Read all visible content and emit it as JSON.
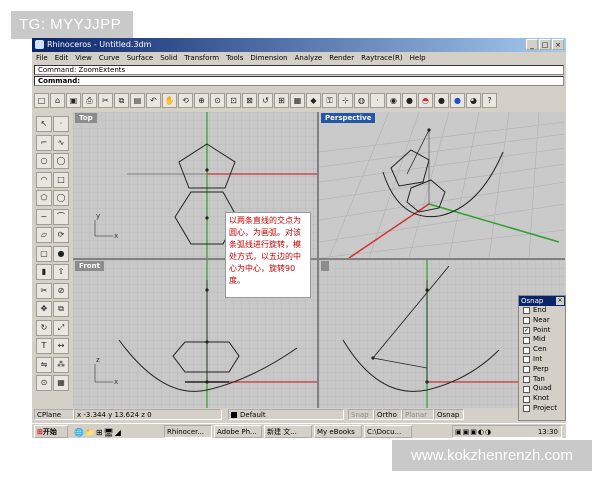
{
  "watermark_top": "TG: MYYJJPP",
  "watermark_bottom": "www.kokzhenrenzh.com",
  "window": {
    "title": "Rhinoceros - Untitled.3dm",
    "buttons": [
      "_",
      "□",
      "×"
    ]
  },
  "menu": [
    "File",
    "Edit",
    "View",
    "Curve",
    "Surface",
    "Solid",
    "Transform",
    "Tools",
    "Dimension",
    "Analyze",
    "Render",
    "Raytrace(R)",
    "Help"
  ],
  "command_history": "Command: ZoomExtents",
  "command_prompt": "Command:",
  "toolbar_icons": [
    "new-icon",
    "open-icon",
    "save-icon",
    "print-icon",
    "cut-icon",
    "copy-icon",
    "paste-icon",
    "undo-icon",
    "pan-icon",
    "rotate-view-icon",
    "zoom-window-icon",
    "zoom-dynamic-icon",
    "zoom-extents-icon",
    "zoom-selected-icon",
    "undo-view-icon",
    "four-viewports-icon",
    "grid-icon",
    "car-icon",
    "lock-icon",
    "snap-icon",
    "hide-icon",
    "point-icon",
    "render-icon",
    "shade-icon",
    "rainbow-icon",
    "sphere-gray-icon",
    "sphere-blue-icon",
    "sphere-color-icon",
    "question-icon"
  ],
  "left_tools": [
    "select-arrow-icon",
    "point-icon",
    "polyline-icon",
    "curve-icon",
    "circle-icon",
    "ellipse-icon",
    "arc-icon",
    "rectangle-icon",
    "polygon-icon",
    "circle-alt-icon",
    "free-curve-icon",
    "fillet-icon",
    "surface-icon",
    "revolve-icon",
    "box-icon",
    "sphere-icon",
    "cylinder-icon",
    "extrude-icon",
    "trim-icon",
    "split-icon",
    "move-icon",
    "copy-icon",
    "rotate-icon",
    "scale-icon",
    "text-icon",
    "dimension-icon",
    "mirror-icon",
    "array-icon",
    "analyze-icon",
    "grid-icon"
  ],
  "viewports": {
    "top": "Top",
    "perspective": "Perspective",
    "front": "Front",
    "right": ""
  },
  "annotation": "以两条直线的交点为圆心，为画弧。对该条弧线进行旋转，模处方式，以五边的中心为中心，旋转90度。",
  "osnap": {
    "title": "Osnap",
    "items": [
      {
        "label": "End",
        "checked": false
      },
      {
        "label": "Near",
        "checked": false
      },
      {
        "label": "Point",
        "checked": true
      },
      {
        "label": "Mid",
        "checked": false
      },
      {
        "label": "Cen",
        "checked": false
      },
      {
        "label": "Int",
        "checked": false
      },
      {
        "label": "Perp",
        "checked": false
      },
      {
        "label": "Tan",
        "checked": false
      },
      {
        "label": "Quad",
        "checked": false
      },
      {
        "label": "Knot",
        "checked": false
      },
      {
        "label": "Project",
        "checked": false
      }
    ]
  },
  "status": {
    "cplane": "CPlane",
    "coords": "x -3.344   y 13.624   z 0",
    "layer": "Default",
    "snap": "Snap",
    "ortho": "Ortho",
    "planar": "Planar",
    "osnap": "Osnap"
  },
  "taskbar": {
    "start": "开始",
    "tasks": [
      "Rhinocer...",
      "Adobe Ph...",
      "新建 文...",
      "My eBooks",
      "C:\\Docu..."
    ],
    "clock": "13:30"
  }
}
